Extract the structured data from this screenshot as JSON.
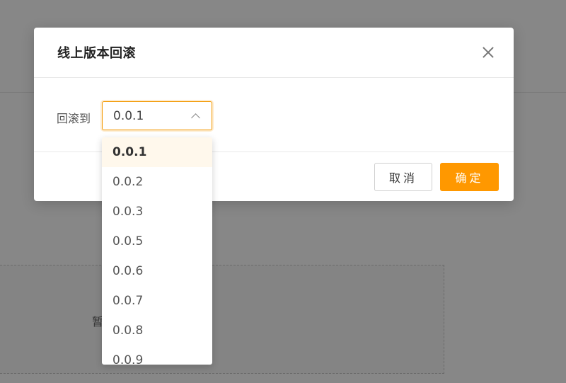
{
  "background": {
    "empty_text": "暂"
  },
  "modal": {
    "title": "线上版本回滚",
    "field_label": "回滚到",
    "select_value": "0.0.1",
    "cancel_label": "取消",
    "ok_label": "确定"
  },
  "dropdown": {
    "options": [
      "0.0.1",
      "0.0.2",
      "0.0.3",
      "0.0.5",
      "0.0.6",
      "0.0.7",
      "0.0.8",
      "0.0.9"
    ],
    "selected": "0.0.1"
  },
  "colors": {
    "accent": "#ff9800",
    "selected_option_bg": "#fff8ec"
  }
}
